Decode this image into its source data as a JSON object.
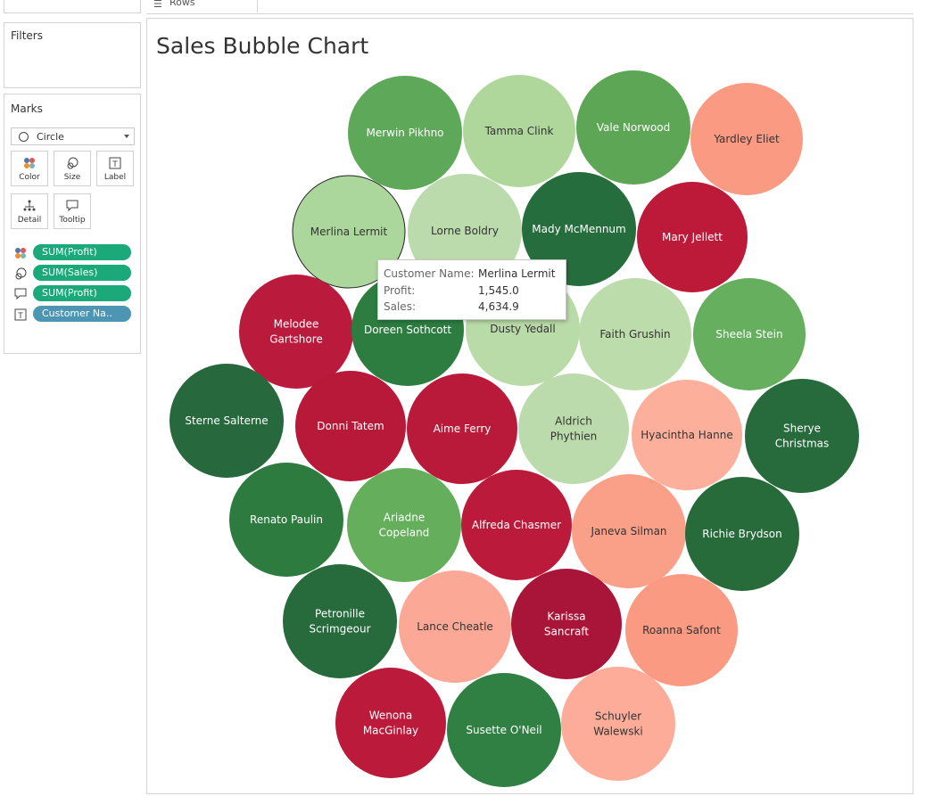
{
  "shelf": {
    "rows_label": "Rows"
  },
  "filters": {
    "title": "Filters"
  },
  "marks": {
    "title": "Marks",
    "mark_type": "Circle",
    "buttons": {
      "color": "Color",
      "size": "Size",
      "label": "Label",
      "detail": "Detail",
      "tooltip": "Tooltip"
    },
    "pills": [
      {
        "icon": "color-icon",
        "text": "SUM(Profit)",
        "color": "#1ba97a"
      },
      {
        "icon": "size-icon",
        "text": "SUM(Sales)",
        "color": "#1ba97a"
      },
      {
        "icon": "tooltip-icon",
        "text": "SUM(Profit)",
        "color": "#1ba97a"
      },
      {
        "icon": "label-icon",
        "text": "Customer Na..",
        "color": "#4c96b4"
      }
    ]
  },
  "sheet": {
    "title": "Sales Bubble Chart"
  },
  "tooltip": {
    "customer_key": "Customer Name:",
    "customer_val": "Merlina Lermit",
    "profit_key": "Profit:",
    "profit_val": "1,545.0",
    "sales_key": "Sales:",
    "sales_val": "4,634.9"
  },
  "colors": {
    "dark_green": "#276b3d",
    "green": "#2f7e43",
    "mid_green": "#5da65a",
    "light_green": "#b6d9a2",
    "crimson": "#ba1839",
    "salmon": "#f99a80",
    "light_salmon": "#fcad98"
  },
  "chart_data": {
    "type": "bubble",
    "title": "Sales Bubble Chart",
    "bubbles": [
      {
        "name": "Merwin Pikhno",
        "color": "#5ea859"
      },
      {
        "name": "Tamma Clink",
        "color": "#afd79c"
      },
      {
        "name": "Vale Norwood",
        "color": "#5da656"
      },
      {
        "name": "Yardley Eliet",
        "color": "#fb9a83"
      },
      {
        "name": "Merlina Lermit",
        "color": "#acd79c",
        "highlighted": true
      },
      {
        "name": "Lorne Boldry",
        "color": "#bcdbac"
      },
      {
        "name": "Mady McMennum",
        "color": "#266d3d"
      },
      {
        "name": "Mary Jellett",
        "color": "#bd1a3a"
      },
      {
        "name": "Melodee Gartshore",
        "color": "#ba1a3b"
      },
      {
        "name": "Doreen Sothcott",
        "color": "#2d7d41"
      },
      {
        "name": "Dusty Yedall",
        "color": "#b9dba8"
      },
      {
        "name": "Faith Grushin",
        "color": "#bddcac"
      },
      {
        "name": "Sheela Stein",
        "color": "#66af5e"
      },
      {
        "name": "Sterne Salterne",
        "color": "#27693d"
      },
      {
        "name": "Donni Tatem",
        "color": "#b91939"
      },
      {
        "name": "Aime Ferry",
        "color": "#ba1a39"
      },
      {
        "name": "Aldrich Phythien",
        "color": "#bcdbac"
      },
      {
        "name": "Hyacintha Hanne",
        "color": "#fcb09c"
      },
      {
        "name": "Sherye Christmas",
        "color": "#276b3c"
      },
      {
        "name": "Renato Paulin",
        "color": "#2e7b3f"
      },
      {
        "name": "Ariadne Copeland",
        "color": "#64ae5c"
      },
      {
        "name": "Alfreda Chasmer",
        "color": "#bb1a3b"
      },
      {
        "name": "Janeva Silman",
        "color": "#fba088"
      },
      {
        "name": "Richie Brydson",
        "color": "#276b3b"
      },
      {
        "name": "Petronille Scrimgeour",
        "color": "#276b3d"
      },
      {
        "name": "Lance Cheatle",
        "color": "#fca896"
      },
      {
        "name": "Karissa Sancraft",
        "color": "#a91538"
      },
      {
        "name": "Roanna Safont",
        "color": "#fb9a82"
      },
      {
        "name": "Wenona MacGinlay",
        "color": "#bb1a3b"
      },
      {
        "name": "Susette O'Neil",
        "color": "#2f8042"
      },
      {
        "name": "Schuyler Walewski",
        "color": "#fcac98"
      }
    ]
  }
}
